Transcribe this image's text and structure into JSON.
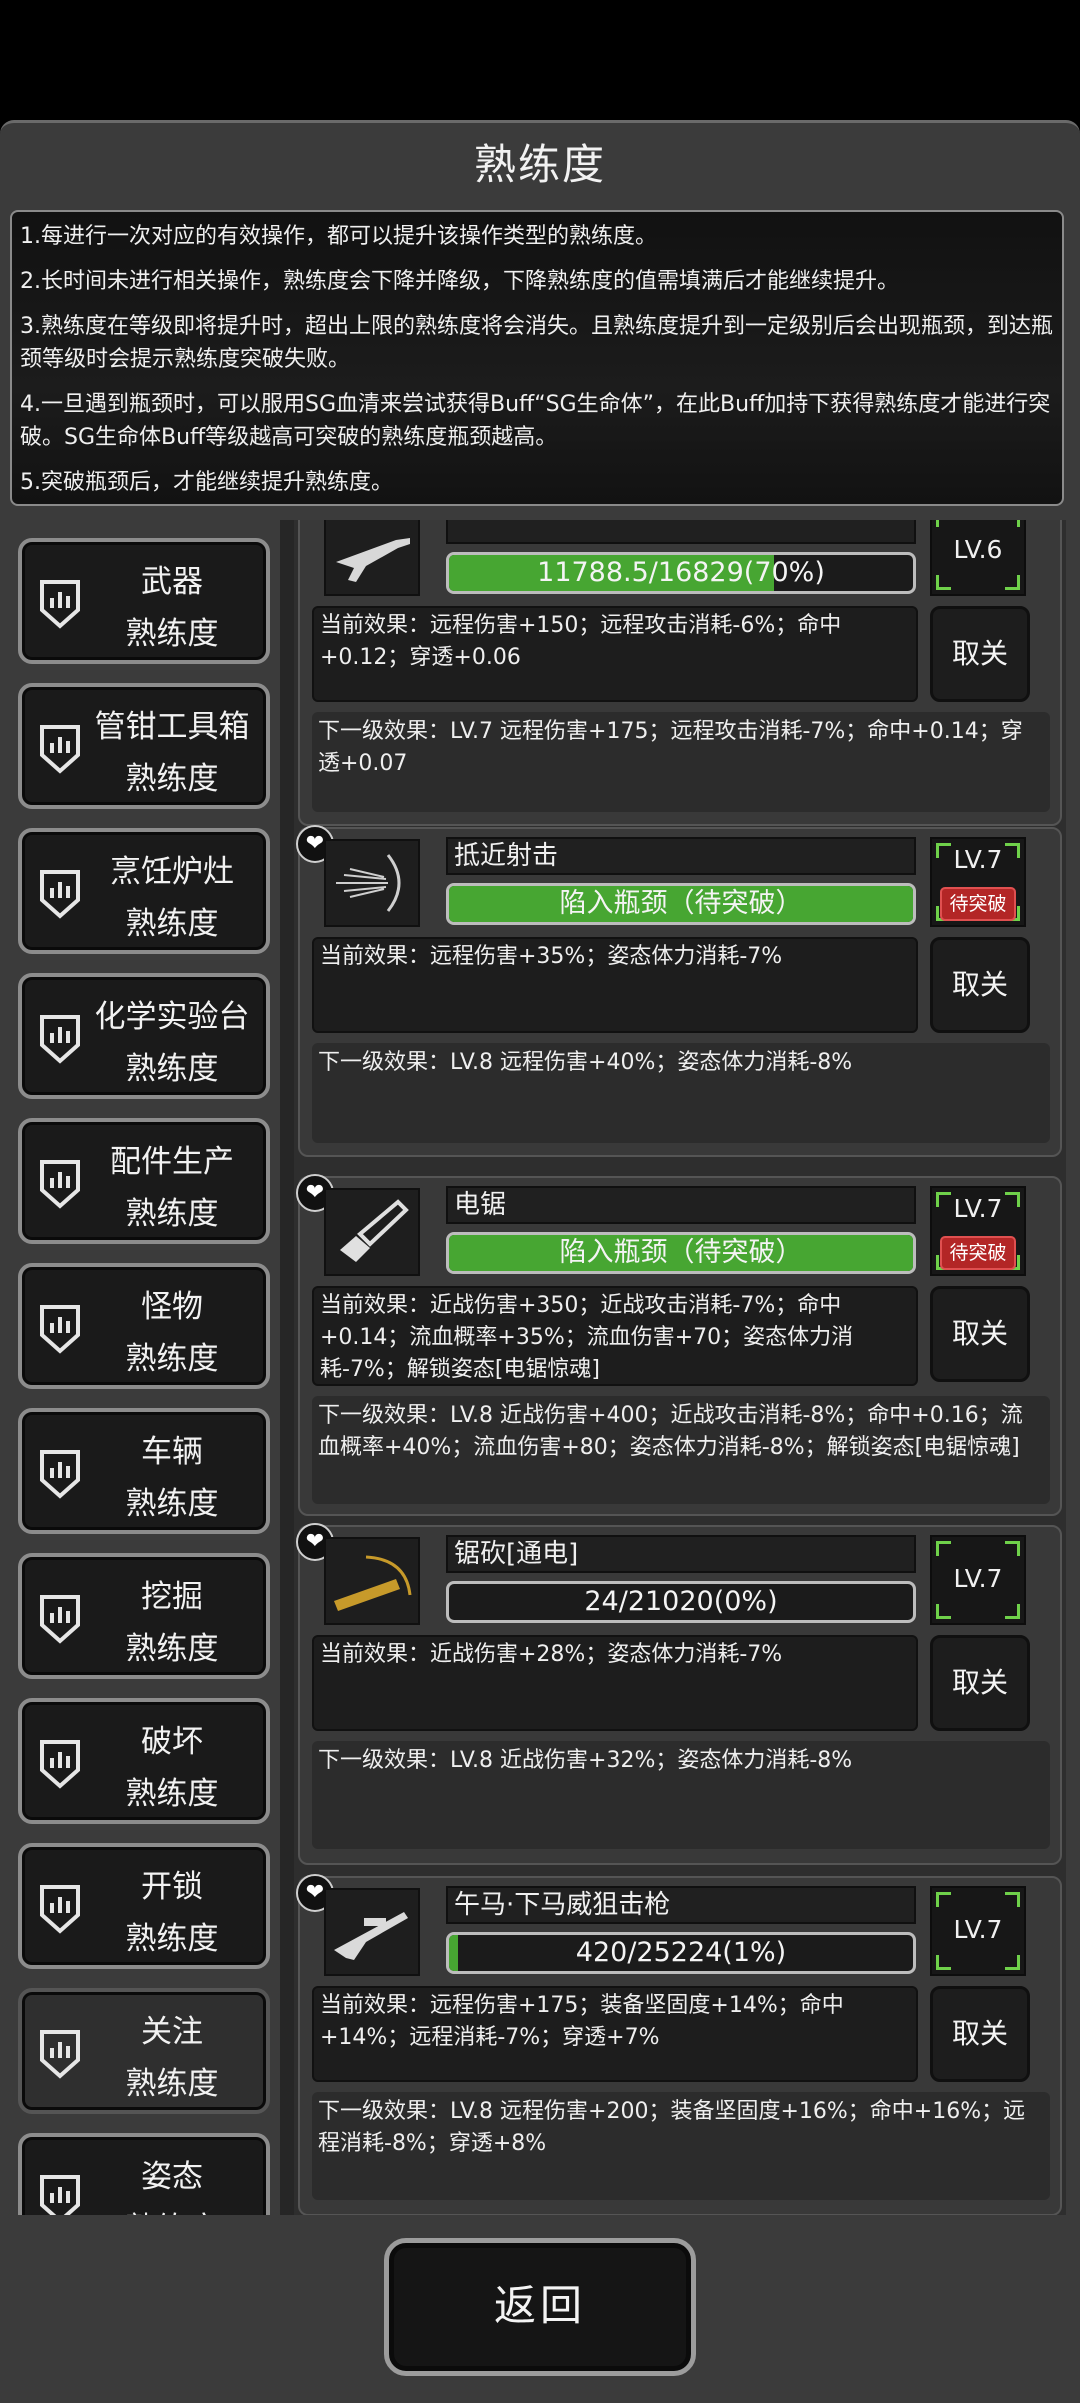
{
  "title": "熟练度",
  "rules": [
    "1.每进行一次对应的有效操作，都可以提升该操作类型的熟练度。",
    "2.长时间未进行相关操作，熟练度会下降并降级，下降熟练度的值需填满后才能继续提升。",
    "3.熟练度在等级即将提升时，超出上限的熟练度将会消失。且熟练度提升到一定级别后会出现瓶颈，到达瓶颈等级时会提示熟练度突破失败。",
    "4.一旦遇到瓶颈时，可以服用SG血清来尝试获得Buff“SG生命体”，在此Buff加持下获得熟练度才能进行突破。SG生命体Buff等级越高可突破的熟练度瓶颈越高。",
    "5.突破瓶颈后，才能继续提升熟练度。"
  ],
  "sidebar": [
    {
      "line1": "武器",
      "line2": "熟练度"
    },
    {
      "line1": "管钳工具箱",
      "line2": "熟练度"
    },
    {
      "line1": "烹饪炉灶",
      "line2": "熟练度"
    },
    {
      "line1": "化学实验台",
      "line2": "熟练度"
    },
    {
      "line1": "配件生产",
      "line2": "熟练度"
    },
    {
      "line1": "怪物",
      "line2": "熟练度"
    },
    {
      "line1": "车辆",
      "line2": "熟练度"
    },
    {
      "line1": "挖掘",
      "line2": "熟练度"
    },
    {
      "line1": "破坏",
      "line2": "熟练度"
    },
    {
      "line1": "开锁",
      "line2": "熟练度"
    },
    {
      "line1": "关注",
      "line2": "熟练度",
      "active": true
    },
    {
      "line1": "姿态",
      "line2": "熟练度"
    }
  ],
  "skills": [
    {
      "name": "",
      "progress": "11788.5/16829(70%)",
      "fill": 0.7,
      "level": "LV.6",
      "breakthrough": "",
      "current": "当前效果：远程伤害+150；远程攻击消耗-6%；命中+0.12；穿透+0.06",
      "next": "下一级效果：LV.7 远程伤害+175；远程攻击消耗-7%；命中+0.14；穿透+0.07",
      "icon": "rifle-icon"
    },
    {
      "name": "抵近射击",
      "progress": "陷入瓶颈（待突破）",
      "fill": 1.0,
      "level": "LV.7",
      "breakthrough": "待突破",
      "current": "当前效果：远程伤害+35%；姿态体力消耗-7%",
      "next": "下一级效果：LV.8 远程伤害+40%；姿态体力消耗-8%",
      "icon": "point-blank-icon"
    },
    {
      "name": "电锯",
      "progress": "陷入瓶颈（待突破）",
      "fill": 1.0,
      "level": "LV.7",
      "breakthrough": "待突破",
      "current": "当前效果：近战伤害+350；近战攻击消耗-7%；命中+0.14；流血概率+35%；流血伤害+70；姿态体力消耗-7%；解锁姿态[电锯惊魂]",
      "next": "下一级效果：LV.8 近战伤害+400；近战攻击消耗-8%；命中+0.16；流血概率+40%；流血伤害+80；姿态体力消耗-8%；解锁姿态[电锯惊魂]",
      "icon": "chainsaw-icon"
    },
    {
      "name": "锯砍[通电]",
      "progress": "24/21020(0%)",
      "fill": 0.0,
      "level": "LV.7",
      "breakthrough": "",
      "current": "当前效果：近战伤害+28%；姿态体力消耗-7%",
      "next": "下一级效果：LV.8 近战伤害+32%；姿态体力消耗-8%",
      "icon": "electric-saw-icon"
    },
    {
      "name": "午马·下马威狙击枪",
      "progress": "420/25224(1%)",
      "fill": 0.017,
      "level": "LV.7",
      "breakthrough": "",
      "current": "当前效果：远程伤害+175；装备坚固度+14%；命中+14%；远程消耗-7%；穿透+7%",
      "next": "下一级效果：LV.8 远程伤害+200；装备坚固度+16%；命中+16%；远程消耗-8%；穿透+8%",
      "icon": "sniper-rifle-icon"
    }
  ],
  "unfollow_label": "取关",
  "heart_glyph": "❤",
  "back_label": "返回"
}
